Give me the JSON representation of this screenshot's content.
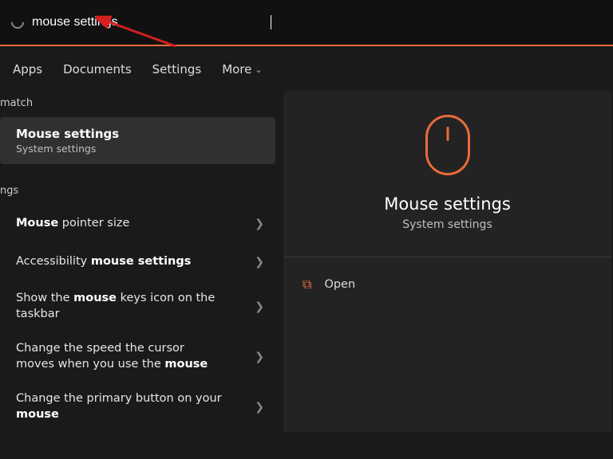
{
  "search": {
    "value": "mouse settings"
  },
  "tabs": {
    "t0": "Apps",
    "t1": "Documents",
    "t2": "Settings",
    "t3": "More"
  },
  "sections": {
    "bestmatch": "match",
    "settings": "ngs"
  },
  "best": {
    "title": "Mouse settings",
    "subtitle": "System settings"
  },
  "results": {
    "r0_pre": "Mouse",
    "r0_post": " pointer size",
    "r1_pre": "Accessibility ",
    "r1_bold": "mouse settings",
    "r2_pre": "Show the ",
    "r2_bold": "mouse",
    "r2_post": " keys icon on the taskbar",
    "r3_pre": "Change the speed the cursor moves when you use the ",
    "r3_bold": "mouse",
    "r4_pre": "Change the primary button on your ",
    "r4_bold": "mouse"
  },
  "detail": {
    "title": "Mouse settings",
    "subtitle": "System settings",
    "open": "Open"
  }
}
